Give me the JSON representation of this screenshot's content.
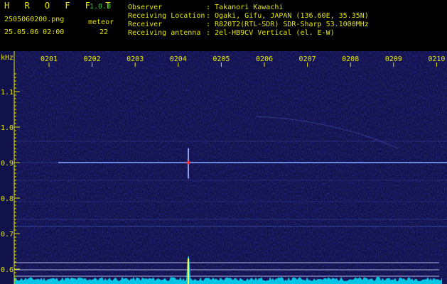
{
  "header": {
    "app_name": "H R O F F T",
    "version": "1.0.0",
    "filename": "2505060200.png",
    "datetime": "25.05.06 02:00",
    "meteor_label": "meteor",
    "meteor_count": "22",
    "info_labels": [
      "Observer",
      "Receiving Location",
      "Receiver",
      "Receiving antenna"
    ],
    "info_values": [
      ": Takanori Kawachi",
      ": Ogaki, Gifu, JAPAN (136.60E, 35.35N)",
      ": R820T2(RTL-SDR) SDR-Sharp 53.1000MHz",
      ": 2el-HB9CV Vertical (el. E-W)"
    ]
  },
  "spectrogram": {
    "y_unit": "kHz",
    "y_ticks": [
      "1.1",
      "1.0",
      "0.9",
      "0.8",
      "0.7",
      "0.6"
    ],
    "x_ticks": [
      "0201",
      "0202",
      "0203",
      "0204",
      "0205",
      "0206",
      "0207",
      "0208",
      "0209",
      "0210"
    ],
    "colors": {
      "background": "#12124a",
      "carrier": "#6f8fe6",
      "axis_text": "#e6e600",
      "tick": "#e6e600",
      "power_trace": "#00e5ff"
    }
  }
}
